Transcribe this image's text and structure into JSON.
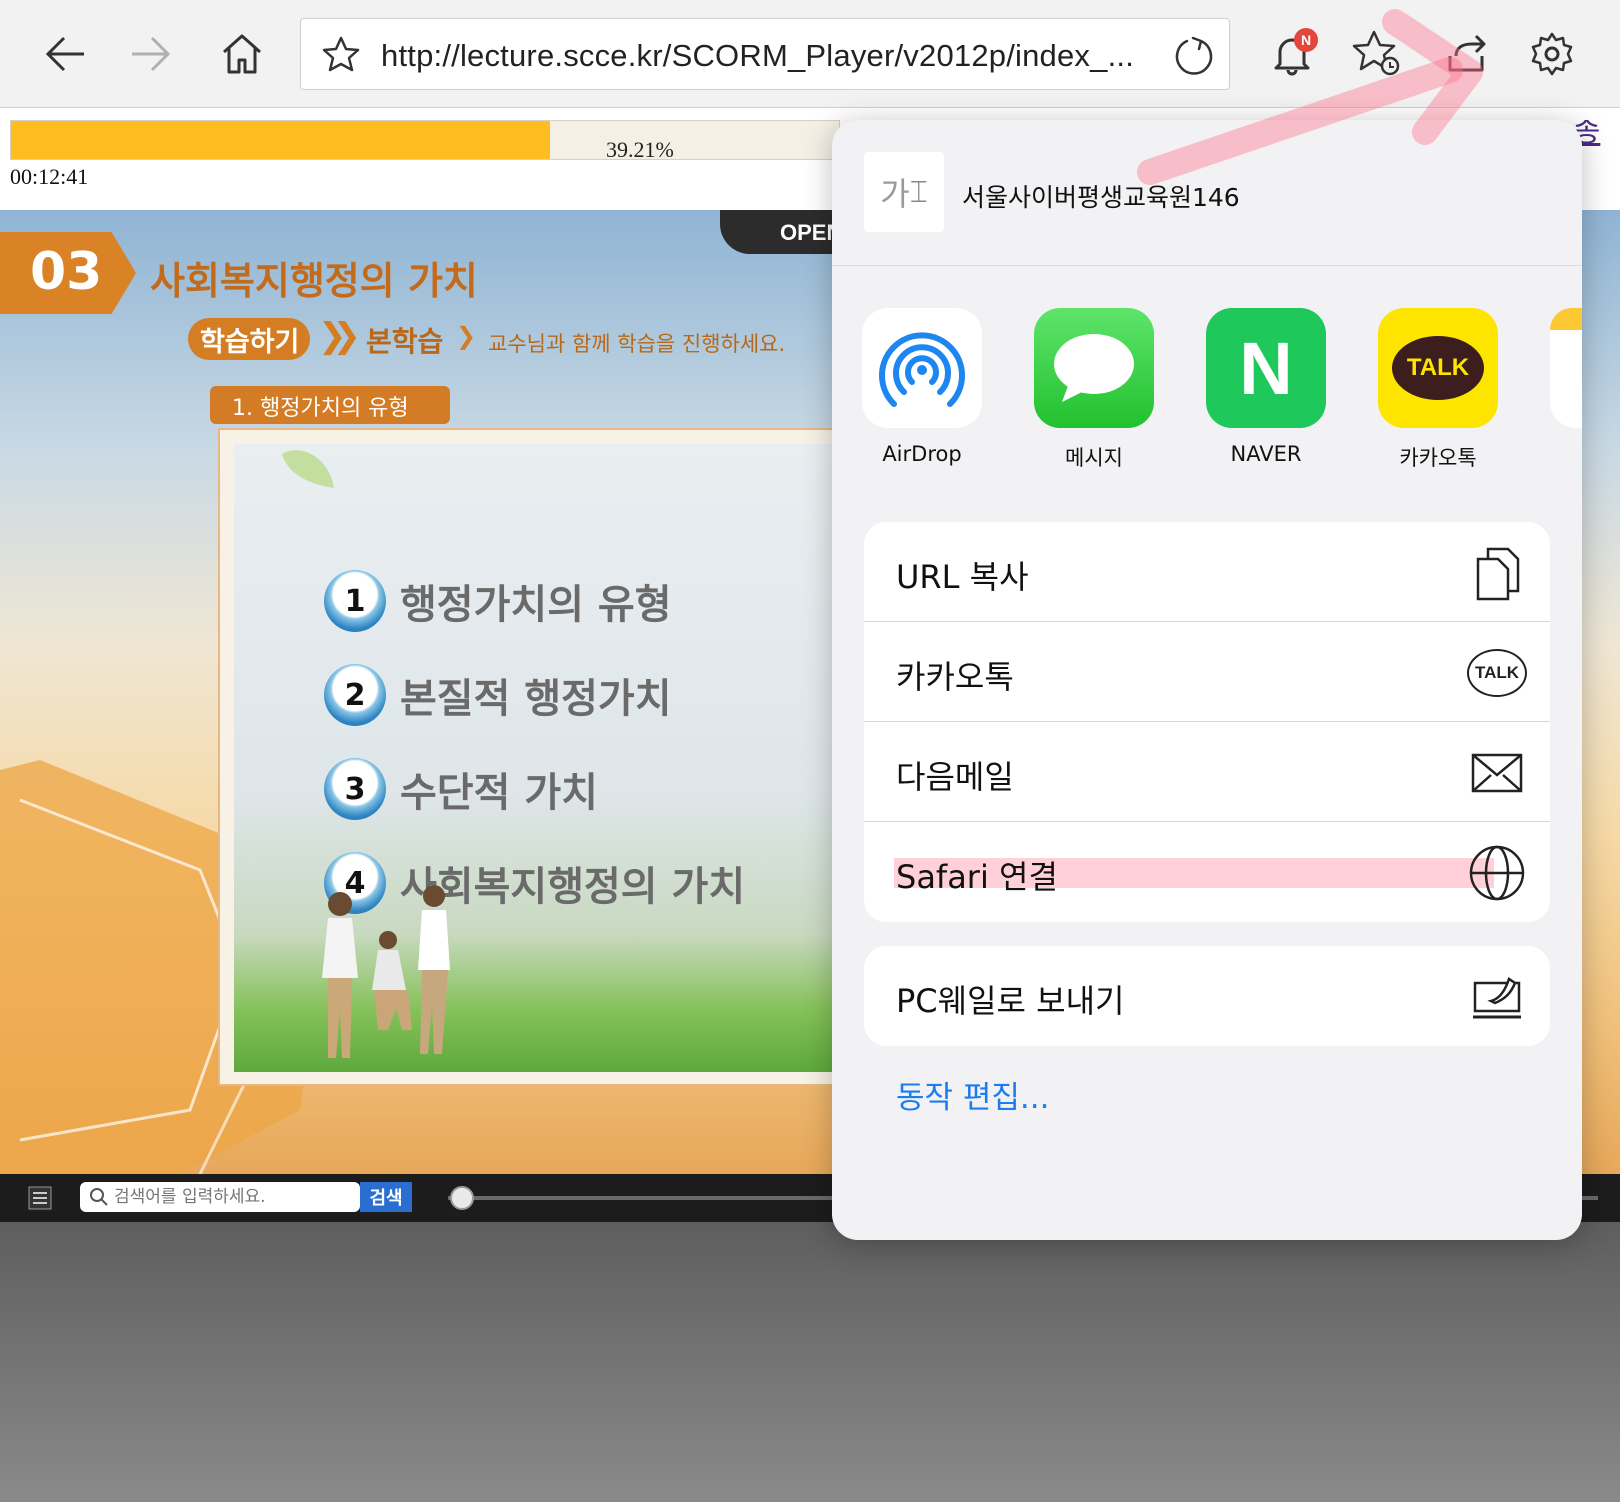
{
  "browser": {
    "url": "http://lecture.scce.kr/SCORM_Player/v2012p/index_...",
    "notification_badge": "N"
  },
  "progress": {
    "percent_label": "39.21%",
    "value": 39.21,
    "elapsed": "00:12:41",
    "close_link": "학습 종료"
  },
  "lecture": {
    "open_tab": "OPEN",
    "section_number": "03",
    "section_title": "사회복지행정의 가치",
    "step_label": "학습하기",
    "step_main": "본학습",
    "step_desc": "교수님과 함께 학습을 진행하세요.",
    "topic_pill": "1. 행정가치의 유형",
    "topics": [
      {
        "num": "1",
        "text": "행정가치의 유형"
      },
      {
        "num": "2",
        "text": "본질적 행정가치"
      },
      {
        "num": "3",
        "text": "수단적 가치"
      },
      {
        "num": "4",
        "text": "사회복지행정의 가치"
      }
    ]
  },
  "player": {
    "search_placeholder": "검색어를 입력하세요.",
    "search_button": "검색"
  },
  "share_sheet": {
    "thumb_text": "가",
    "title": "서울사이버평생교육원146",
    "apps": [
      {
        "label": "AirDrop"
      },
      {
        "label": "메시지"
      },
      {
        "label": "NAVER",
        "icon_text": "N"
      },
      {
        "label": "카카오톡",
        "icon_text": "TALK"
      }
    ],
    "actions": [
      {
        "label": "URL 복사"
      },
      {
        "label": "카카오톡",
        "icon_text": "TALK"
      },
      {
        "label": "다음메일"
      },
      {
        "label": "Safari 연결"
      }
    ],
    "secondary_action": "PC웨일로 보내기",
    "edit_actions": "동작 편집..."
  },
  "colors": {
    "progress_fill": "#ffbd20",
    "accent_orange": "#d98226",
    "ios_link": "#1c7cf2",
    "highlight": "#ff788c",
    "annotation_arrow": "#ff6f8a"
  }
}
